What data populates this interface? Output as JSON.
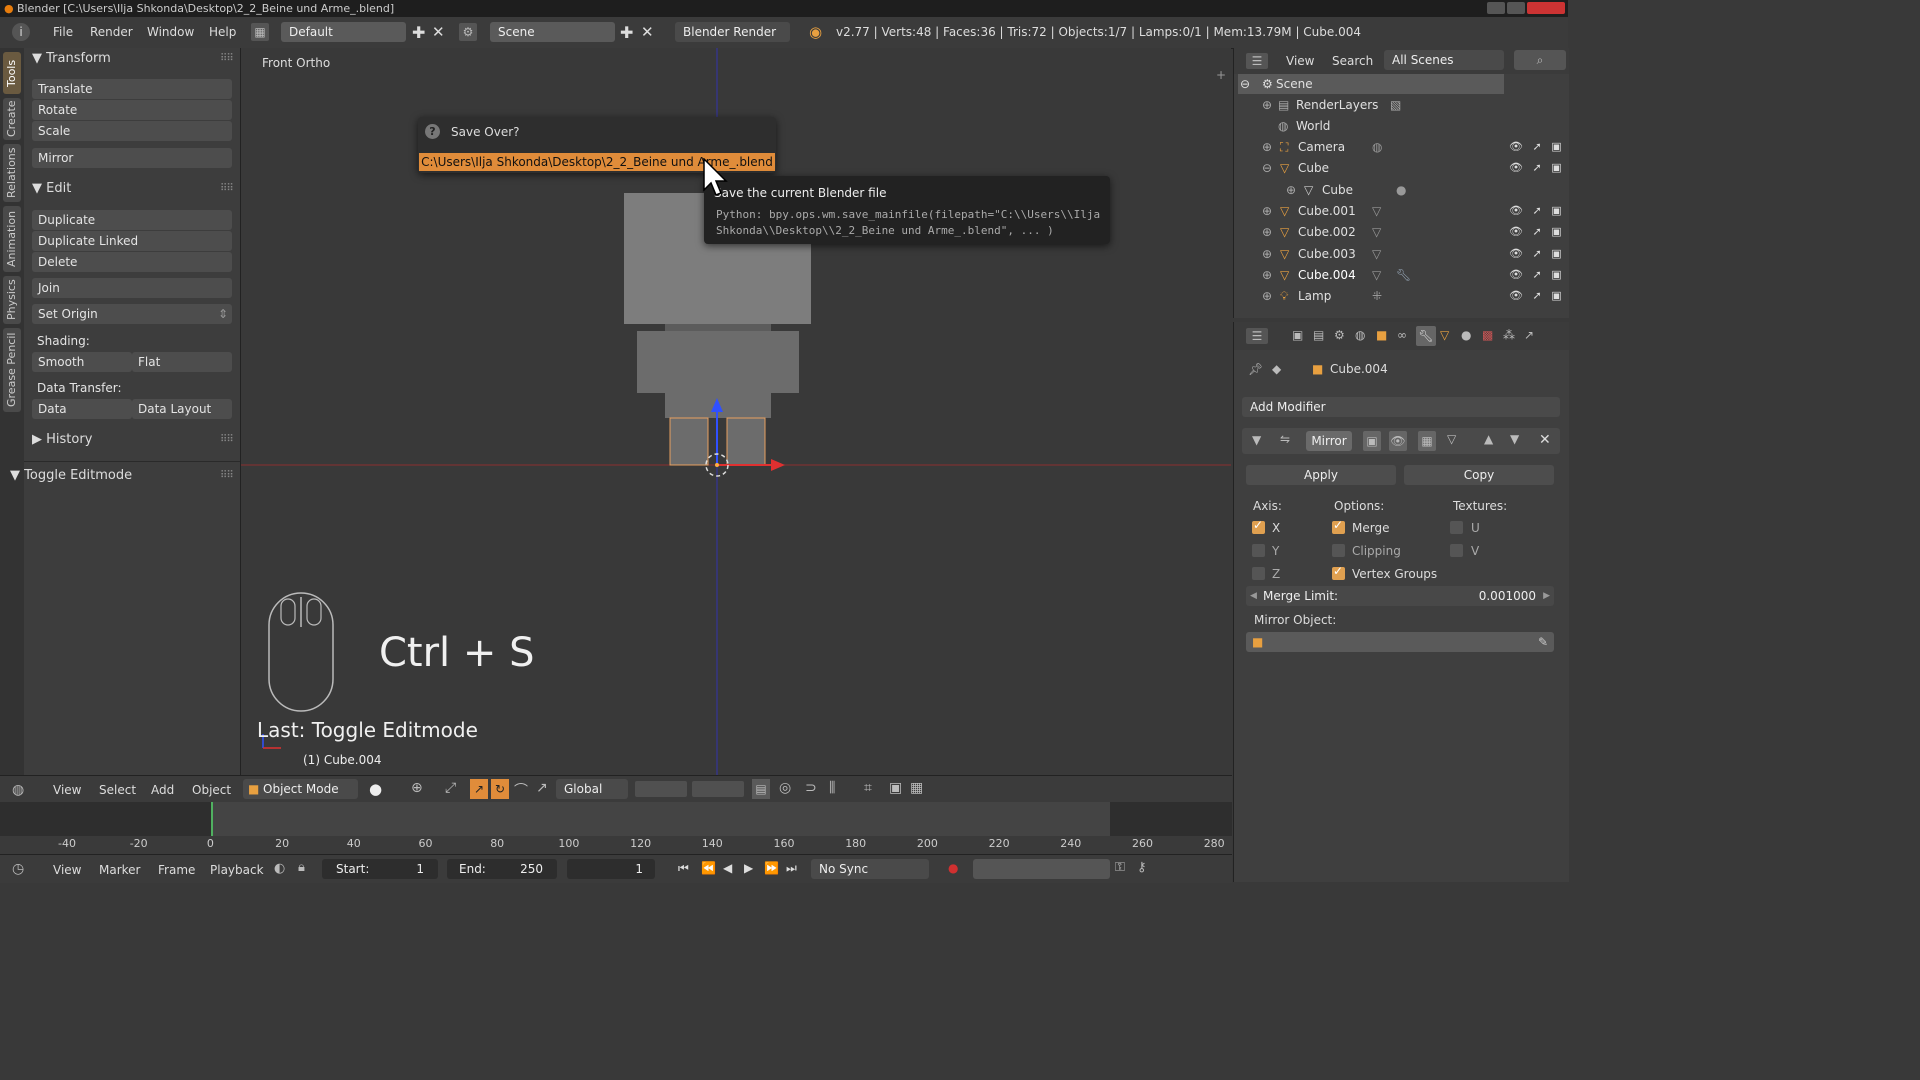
{
  "window_title": "Blender [C:\\Users\\Ilja Shkonda\\Desktop\\2_2_Beine und Arme_.blend]",
  "top_menu": [
    "File",
    "Render",
    "Window",
    "Help"
  ],
  "screen_layout": "Default",
  "scene": "Scene",
  "render_engine": "Blender Render",
  "stats": "v2.77 | Verts:48 | Faces:36 | Tris:72 | Objects:1/7 | Lamps:0/1 | Mem:13.79M | Cube.004",
  "tool_tabs": [
    "Tools",
    "Create",
    "Relations",
    "Animation",
    "Physics",
    "Grease Pencil"
  ],
  "toolshelf": {
    "transform_header": "Transform",
    "translate": "Translate",
    "rotate": "Rotate",
    "scale": "Scale",
    "mirror": "Mirror",
    "edit_header": "Edit",
    "duplicate": "Duplicate",
    "duplicate_linked": "Duplicate Linked",
    "delete": "Delete",
    "join": "Join",
    "set_origin": "Set Origin",
    "shading_label": "Shading:",
    "smooth": "Smooth",
    "flat": "Flat",
    "data_transfer_label": "Data Transfer:",
    "data": "Data",
    "data_layout": "Data Layout",
    "history_header": "History",
    "toggle_editmode_header": "Toggle Editmode"
  },
  "viewport": {
    "view_name": "Front Ortho",
    "shortcut_overlay": "Ctrl + S",
    "last_operator": "Last: Toggle Editmode",
    "object_info": "(1) Cube.004"
  },
  "popup": {
    "title": "Save Over?",
    "filepath": "C:\\Users\\Ilja Shkonda\\Desktop\\2_2_Beine und Arme_.blend"
  },
  "tooltip": {
    "title": "Save the current Blender file",
    "python_line1": "Python: bpy.ops.wm.save_mainfile(filepath=\"C:\\\\Users\\\\Ilja",
    "python_line2": "Shkonda\\\\Desktop\\\\2_2_Beine und Arme_.blend\", ... )"
  },
  "viewport_header": {
    "view": "View",
    "select": "Select",
    "add": "Add",
    "object": "Object",
    "mode": "Object Mode",
    "orientation": "Global"
  },
  "timeline": {
    "ticks": [
      "-40",
      "-20",
      "0",
      "20",
      "40",
      "60",
      "80",
      "100",
      "120",
      "140",
      "160",
      "180",
      "200",
      "220",
      "240",
      "260",
      "280"
    ],
    "view": "View",
    "marker": "Marker",
    "frame": "Frame",
    "playback": "Playback",
    "start_label": "Start:",
    "start_value": "1",
    "end_label": "End:",
    "end_value": "250",
    "current_frame": "1",
    "sync": "No Sync"
  },
  "outliner": {
    "view": "View",
    "search": "Search",
    "filter": "All Scenes",
    "items": [
      "Scene",
      "RenderLayers",
      "World",
      "Camera",
      "Cube",
      "Cube",
      "Cube.001",
      "Cube.002",
      "Cube.003",
      "Cube.004",
      "Lamp"
    ]
  },
  "properties": {
    "object_name": "Cube.004",
    "add_modifier": "Add Modifier",
    "modifier_name": "Mirror",
    "apply": "Apply",
    "copy": "Copy",
    "axis_label": "Axis:",
    "options_label": "Options:",
    "textures_label": "Textures:",
    "x": "X",
    "y": "Y",
    "z": "Z",
    "merge": "Merge",
    "clipping": "Clipping",
    "vertex_groups": "Vertex Groups",
    "u": "U",
    "v": "V",
    "merge_limit_label": "Merge Limit:",
    "merge_limit_value": "0.001000",
    "mirror_object_label": "Mirror Object:"
  }
}
